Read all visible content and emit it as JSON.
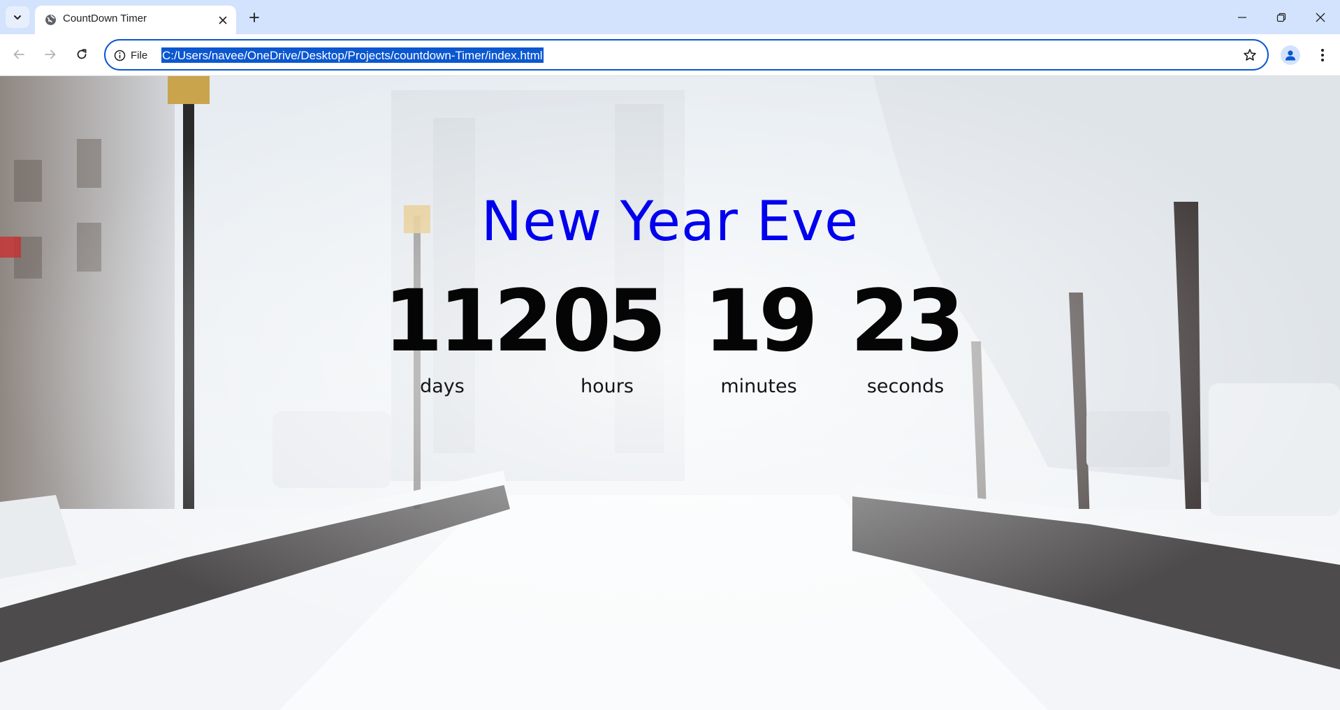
{
  "browser": {
    "tab": {
      "title": "CountDown Timer"
    },
    "address_bar": {
      "security_label": "File",
      "url": "C:/Users/navee/OneDrive/Desktop/Projects/countdown-Timer/index.html"
    },
    "icons": {
      "tab_search": "chevron-down-icon",
      "favicon": "globe-icon",
      "tab_close": "close-icon",
      "new_tab": "plus-icon",
      "minimize": "minimize-icon",
      "restore": "restore-icon",
      "close_window": "close-icon",
      "back": "arrow-left-icon",
      "forward": "arrow-right-icon",
      "reload": "reload-icon",
      "site_info": "info-icon",
      "bookmark": "star-icon",
      "profile": "person-icon",
      "menu": "kebab-menu-icon"
    },
    "colors": {
      "tabbar": "#d3e3fd",
      "omnibox_border": "#0b57d0",
      "url_selection": "#0b57d0"
    }
  },
  "page": {
    "title": "New Year Eve",
    "title_color": "#0000ee",
    "countdown": [
      {
        "value": "112",
        "label": "days"
      },
      {
        "value": "05",
        "label": "hours"
      },
      {
        "value": "19",
        "label": "minutes"
      },
      {
        "value": "23",
        "label": "seconds"
      }
    ],
    "background": "snowy-street-photo"
  }
}
